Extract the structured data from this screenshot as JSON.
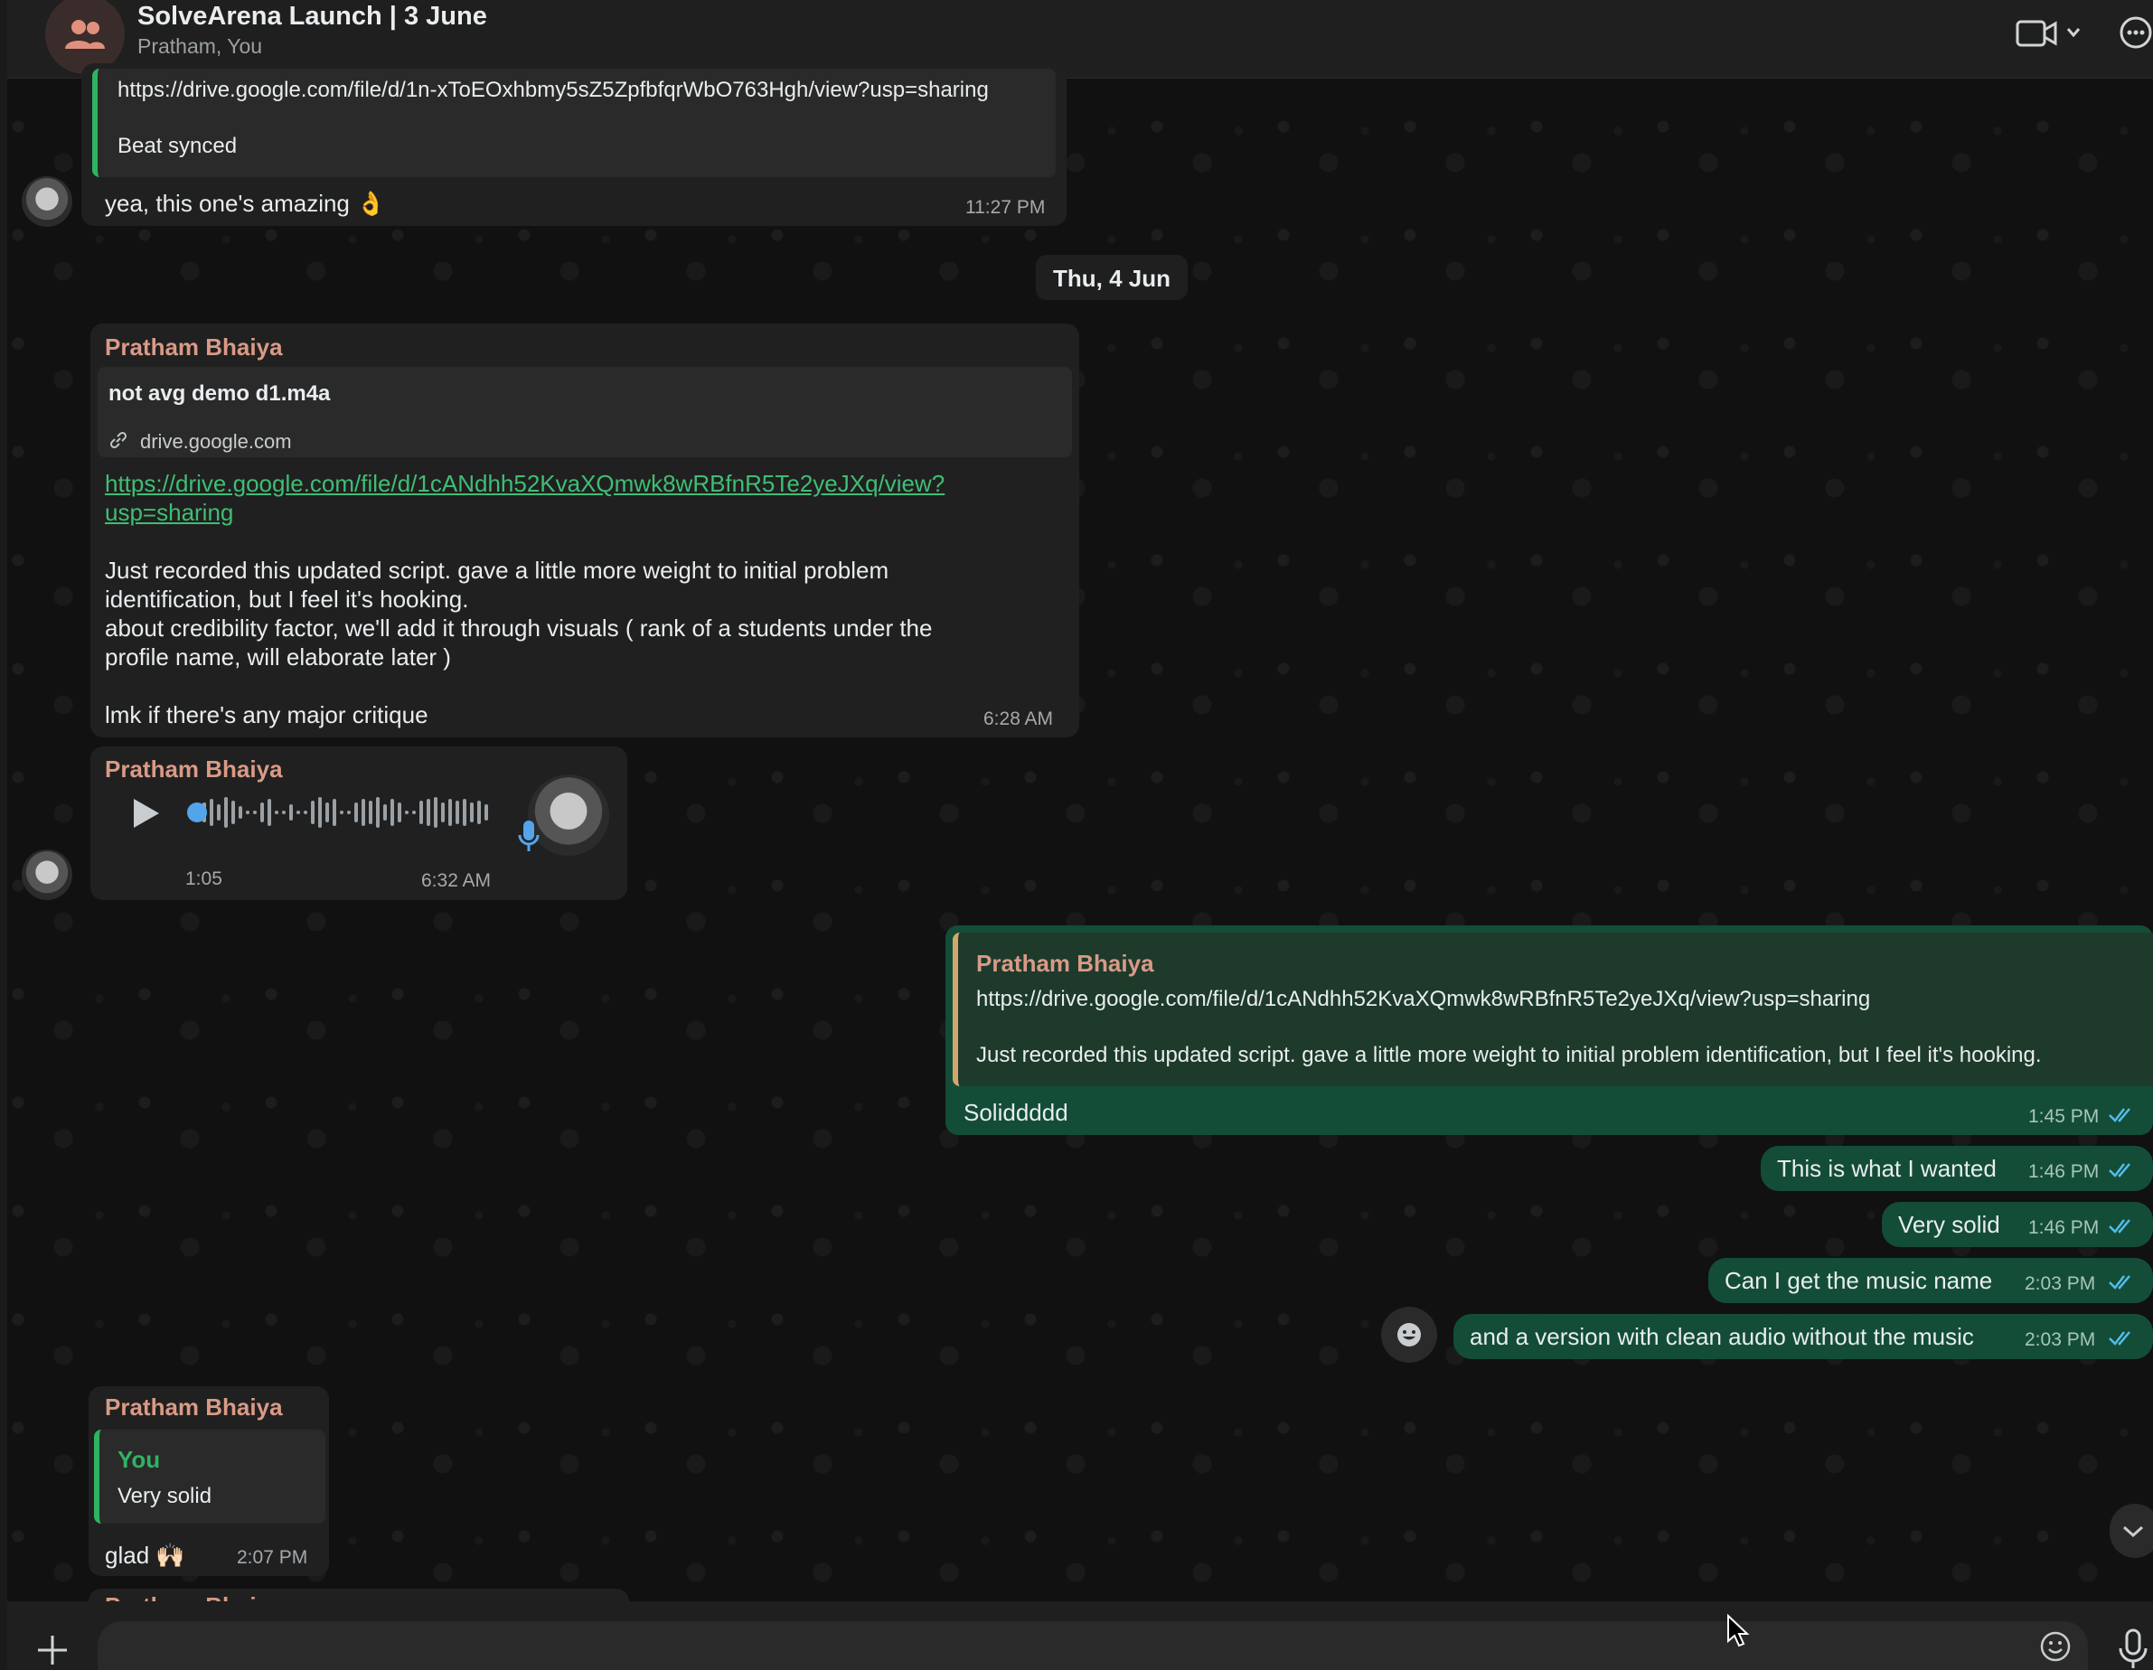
{
  "header": {
    "title": "SolveArena Launch | 3 June",
    "subtitle": "Pratham, You"
  },
  "messages": {
    "m0": {
      "quote_link": "https://drive.google.com/file/d/1n-xToEOxhbmy5sZ5ZpfbfqrWbO763Hgh/view?usp=sharing",
      "quote_text": "Beat synced",
      "text": "yea, this one's amazing 👌",
      "time": "11:27 PM"
    },
    "date_divider": "Thu, 4 Jun",
    "m1": {
      "sender": "Pratham Bhaiya",
      "preview_title": "not avg demo d1.m4a",
      "preview_domain": "drive.google.com",
      "link_line1": "https://drive.google.com/file/d/1cANdhh52KvaXQmwk8wRBfnR5Te2yeJXq/view?",
      "link_line2": "usp=sharing",
      "body_line1": "Just recorded this updated script. gave a little more weight to initial problem",
      "body_line2": "identification, but I feel it's hooking.",
      "body_line3": "about credibility factor, we'll add it through visuals ( rank of a students under the",
      "body_line4": "profile name, will elaborate later )",
      "body_line5": "lmk if there's any major critique",
      "time": "6:28 AM"
    },
    "m2": {
      "sender": "Pratham Bhaiya",
      "duration": "1:05",
      "time": "6:32 AM",
      "progress": 0
    },
    "m3": {
      "quote_sender": "Pratham Bhaiya",
      "quote_link": "https://drive.google.com/file/d/1cANdhh52KvaXQmwk8wRBfnR5Te2yeJXq/view?usp=sharing",
      "quote_text": "Just recorded this updated script. gave a little more weight to initial problem identification, but I feel it's hooking.",
      "text": "Soliddddd",
      "time": "1:45 PM"
    },
    "m4": {
      "text": "This is what I wanted",
      "time": "1:46 PM"
    },
    "m5": {
      "text": "Very solid",
      "time": "1:46 PM"
    },
    "m6": {
      "text": "Can I get the music name",
      "time": "2:03 PM"
    },
    "m7": {
      "text": "and a version with clean audio without the music",
      "time": "2:03 PM"
    },
    "m8": {
      "sender": "Pratham Bhaiya",
      "quote_sender": "You",
      "quote_text": "Very solid",
      "text": "glad 🙌🏻",
      "time": "2:07 PM"
    },
    "m9": {
      "sender": "Pratham Bhaiya"
    }
  },
  "composer": {
    "placeholder": ""
  },
  "colors": {
    "outgoing_bubble": "#134d37",
    "incoming_bubble": "#202020",
    "sender_name": "#d99a86",
    "link": "#3fbe74",
    "read_ticks": "#53bdeb"
  }
}
